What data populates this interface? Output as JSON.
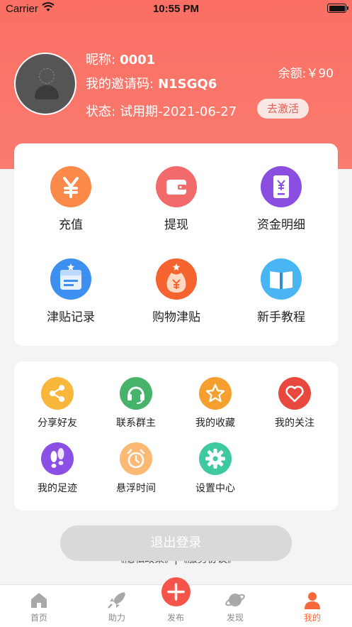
{
  "status_bar": {
    "carrier": "Carrier",
    "time": "10:55 PM"
  },
  "profile": {
    "nickname_label": "昵称:",
    "nickname": "0001",
    "invite_label": "我的邀请码:",
    "invite_code": "N1SGQ6",
    "status_label": "状态:",
    "status_value": "试用期-2021-06-27",
    "activate_label": "去激活",
    "balance": "余额:￥90"
  },
  "main_menu": [
    {
      "label": "充值",
      "icon": "yen-icon",
      "color": "#fb8a4a"
    },
    {
      "label": "提现",
      "icon": "wallet-icon",
      "color": "#f26a6a"
    },
    {
      "label": "资金明细",
      "icon": "ledger-icon",
      "color": "#8a4fe0"
    },
    {
      "label": "津贴记录",
      "icon": "record-box-icon",
      "color": "#3d90f0"
    },
    {
      "label": "购物津贴",
      "icon": "money-bag-icon",
      "color": "#f5642f"
    },
    {
      "label": "新手教程",
      "icon": "book-icon",
      "color": "#49b6f3"
    }
  ],
  "sub_menu": [
    {
      "label": "分享好友",
      "icon": "share-icon",
      "color": "#f8b63a"
    },
    {
      "label": "联系群主",
      "icon": "headset-icon",
      "color": "#47b36a"
    },
    {
      "label": "我的收藏",
      "icon": "star-icon",
      "color": "#f5a02e"
    },
    {
      "label": "我的关注",
      "icon": "heart-icon",
      "color": "#e8483e"
    },
    {
      "label": "我的足迹",
      "icon": "footprint-icon",
      "color": "#8c4fe6"
    },
    {
      "label": "悬浮时间",
      "icon": "alarm-clock-icon",
      "color": "#fbb973"
    },
    {
      "label": "设置中心",
      "icon": "gear-icon",
      "color": "#3ec9a0"
    }
  ],
  "logout_label": "退出登录",
  "policy_text": "《隐私政策》|《服务协议》",
  "tabbar": {
    "home": "首页",
    "assist": "助力",
    "publish": "发布",
    "discover": "发现",
    "mine": "我的"
  },
  "colors": {
    "accent": "#fb6f64",
    "tab_active": "#f5693a"
  }
}
